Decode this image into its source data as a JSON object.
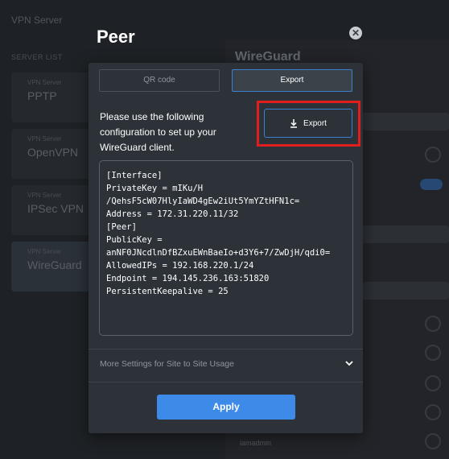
{
  "background": {
    "title": "VPN Server",
    "section_label": "SERVER LIST",
    "cards": [
      {
        "small": "VPN Server",
        "big": "PPTP"
      },
      {
        "small": "VPN Server",
        "big": "OpenVPN"
      },
      {
        "small": "VPN Server",
        "big": "IPSec VPN"
      },
      {
        "small": "VPN Server",
        "big": "WireGuard"
      }
    ],
    "right_title": "WireGuard",
    "footer_text": "iamadmin"
  },
  "modal": {
    "title": "Peer",
    "tabs": [
      {
        "label": "QR code"
      },
      {
        "label": "Export"
      }
    ],
    "instructions": "Please use the following configuration to set up your WireGuard client.",
    "export_button": "Export",
    "config_text": "[Interface]\nPrivateKey = mIKu/H\n/QehsF5cW07HlyIaWD4gEw2iUt5YmYZtHFN1c=\nAddress = 172.31.220.11/32\n[Peer]\nPublicKey =\nanNF0JNcdlnDfBZxuEWnBaeIo+d3Y6+7/ZwDjH/qdi0=\nAllowedIPs = 192.168.220.1/24\nEndpoint = 194.145.236.163:51820\nPersistentKeepalive = 25",
    "more_settings": "More Settings for Site to Site Usage",
    "apply_button": "Apply"
  },
  "colors": {
    "accent": "#3e8ae8",
    "highlight": "#e01e1e",
    "modal_bg": "#2c3237"
  },
  "icons": {
    "close": "close-icon",
    "download": "download-icon",
    "chevron": "chevron-down-icon"
  }
}
